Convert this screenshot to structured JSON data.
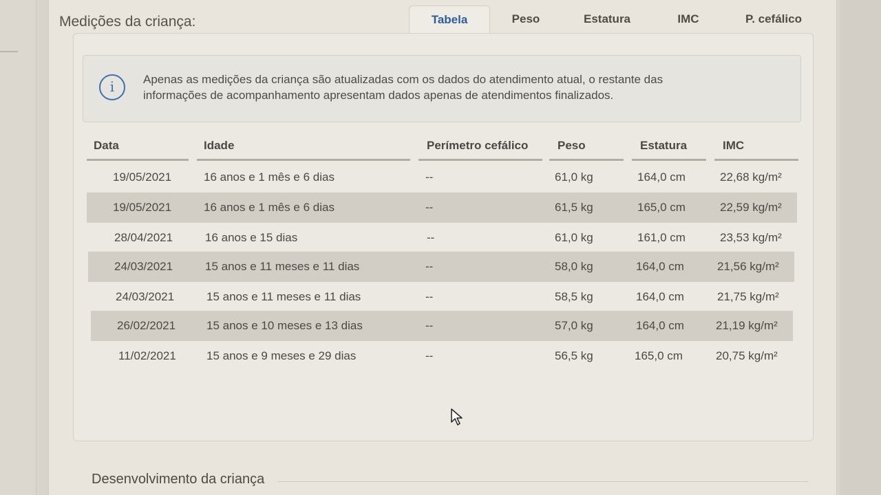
{
  "section": {
    "title": "Medições da criança:",
    "tabs": [
      {
        "label": "Tabela",
        "active": true
      },
      {
        "label": "Peso",
        "active": false
      },
      {
        "label": "Estatura",
        "active": false
      },
      {
        "label": "IMC",
        "active": false
      },
      {
        "label": "P. cefálico",
        "active": false
      }
    ]
  },
  "info": {
    "icon": "info-icon",
    "line1": "Apenas as medições da criança são atualizadas com os dados do atendimento atual, o restante das",
    "line2": "informações de acompanhamento apresentam dados apenas de atendimentos finalizados."
  },
  "table": {
    "headers": [
      "Data",
      "Idade",
      "Perímetro cefálico",
      "Peso",
      "Estatura",
      "IMC"
    ],
    "rows": [
      [
        "19/05/2021",
        "16 anos e 1 mês e 6 dias",
        "--",
        "61,0 kg",
        "164,0 cm",
        "22,68 kg/m²"
      ],
      [
        "19/05/2021",
        "16 anos e 1 mês e 6 dias",
        "--",
        "61,5 kg",
        "165,0 cm",
        "22,59 kg/m²"
      ],
      [
        "28/04/2021",
        "16 anos e 15 dias",
        "--",
        "61,0 kg",
        "161,0 cm",
        "23,53 kg/m²"
      ],
      [
        "24/03/2021",
        "15 anos e 11 meses e 11 dias",
        "--",
        "58,0 kg",
        "164,0 cm",
        "21,56 kg/m²"
      ],
      [
        "24/03/2021",
        "15 anos e 11 meses e 11 dias",
        "--",
        "58,5 kg",
        "164,0 cm",
        "21,75 kg/m²"
      ],
      [
        "26/02/2021",
        "15 anos e 10 meses e 13 dias",
        "--",
        "57,0 kg",
        "164,0 cm",
        "21,19 kg/m²"
      ],
      [
        "11/02/2021",
        "15 anos e 9 meses e 29 dias",
        "--",
        "56,5 kg",
        "165,0 cm",
        "20,75 kg/m²"
      ]
    ]
  },
  "development": {
    "title": "Desenvolvimento da criança"
  },
  "colors": {
    "accent": "#2f5d9a",
    "row_shade": "#d2cec5"
  }
}
